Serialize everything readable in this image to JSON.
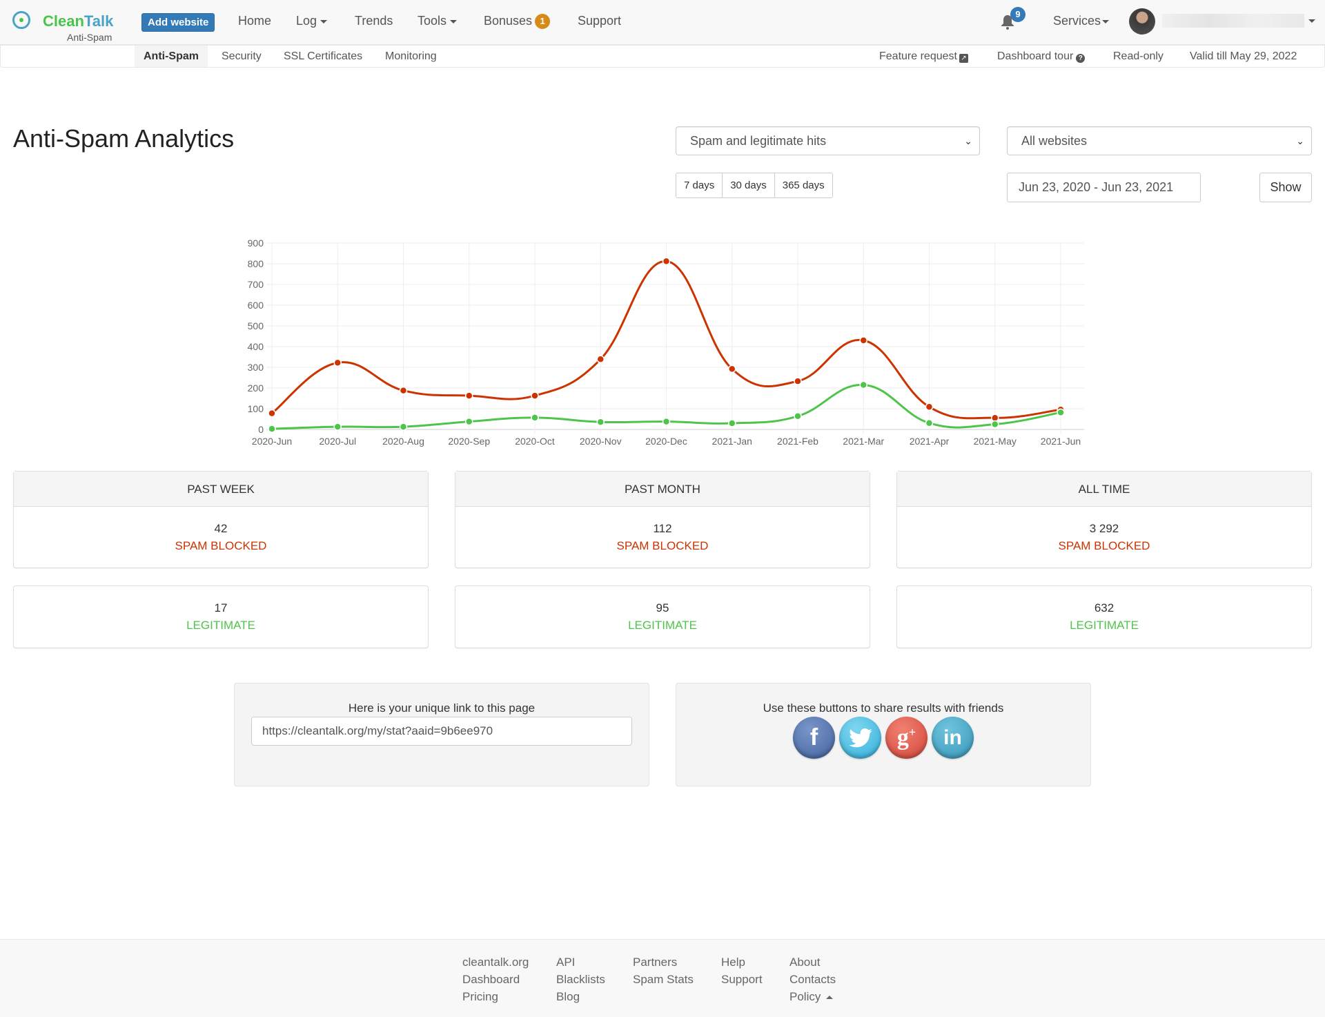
{
  "header": {
    "brand_clean": "Clean",
    "brand_talk": "Talk",
    "brand_sub": "Anti-Spam",
    "add_website": "Add website",
    "nav": [
      {
        "label": "Home"
      },
      {
        "label": "Log",
        "dropdown": true
      },
      {
        "label": "Trends"
      },
      {
        "label": "Tools",
        "dropdown": true
      },
      {
        "label": "Bonuses",
        "badge": "1"
      },
      {
        "label": "Support"
      }
    ],
    "notifications_count": "9",
    "services": "Services"
  },
  "subnav": {
    "tabs": [
      "Anti-Spam",
      "Security",
      "SSL Certificates",
      "Monitoring"
    ],
    "active": "Anti-Spam",
    "feature_request": "Feature request",
    "dashboard_tour": "Dashboard tour",
    "read_only": "Read-only",
    "valid_till": "Valid till May 29, 2022"
  },
  "page": {
    "title": "Anti-Spam Analytics",
    "hits_select": "Spam and legitimate hits",
    "websites_select": "All websites",
    "ranges": [
      "7 days",
      "30 days",
      "365 days"
    ],
    "date_range": "Jun 23, 2020 - Jun 23, 2021",
    "show": "Show"
  },
  "chart_data": {
    "type": "line",
    "title": "",
    "xlabel": "",
    "ylabel": "",
    "categories": [
      "2020-Jun",
      "2020-Jul",
      "2020-Aug",
      "2020-Sep",
      "2020-Oct",
      "2020-Nov",
      "2020-Dec",
      "2021-Jan",
      "2021-Feb",
      "2021-Mar",
      "2021-Apr",
      "2021-May",
      "2021-Jun"
    ],
    "ylim": [
      0,
      900
    ],
    "yticks": [
      0,
      100,
      200,
      300,
      400,
      500,
      600,
      700,
      800,
      900
    ],
    "grid": true,
    "legend": "none",
    "series": [
      {
        "name": "Spam",
        "color": "#cc3300",
        "values": [
          78,
          322,
          188,
          163,
          163,
          339,
          812,
          292,
          233,
          430,
          109,
          56,
          96
        ]
      },
      {
        "name": "Legitimate",
        "color": "#4fc44a",
        "values": [
          3,
          13,
          13,
          38,
          57,
          36,
          38,
          30,
          64,
          215,
          31,
          25,
          82
        ]
      }
    ]
  },
  "stats": [
    {
      "period": "PAST WEEK",
      "spam": "42",
      "legit": "17"
    },
    {
      "period": "PAST MONTH",
      "spam": "112",
      "legit": "95"
    },
    {
      "period": "ALL TIME",
      "spam": "3 292",
      "legit": "632"
    }
  ],
  "labels": {
    "spam": "SPAM BLOCKED",
    "legit": "LEGITIMATE"
  },
  "share": {
    "link_title": "Here is your unique link to this page",
    "link_value": "https://cleantalk.org/my/stat?aaid=9b6ee970",
    "share_title": "Use these buttons to share results with friends",
    "networks": [
      "facebook",
      "twitter",
      "google-plus",
      "linkedin"
    ]
  },
  "footer": {
    "columns": [
      [
        "cleantalk.org",
        "Dashboard",
        "Pricing"
      ],
      [
        "API",
        "Blacklists",
        "Blog"
      ],
      [
        "Partners",
        "Spam Stats"
      ],
      [
        "Help",
        "Support"
      ],
      [
        "About",
        "Contacts",
        "Policy"
      ]
    ]
  }
}
